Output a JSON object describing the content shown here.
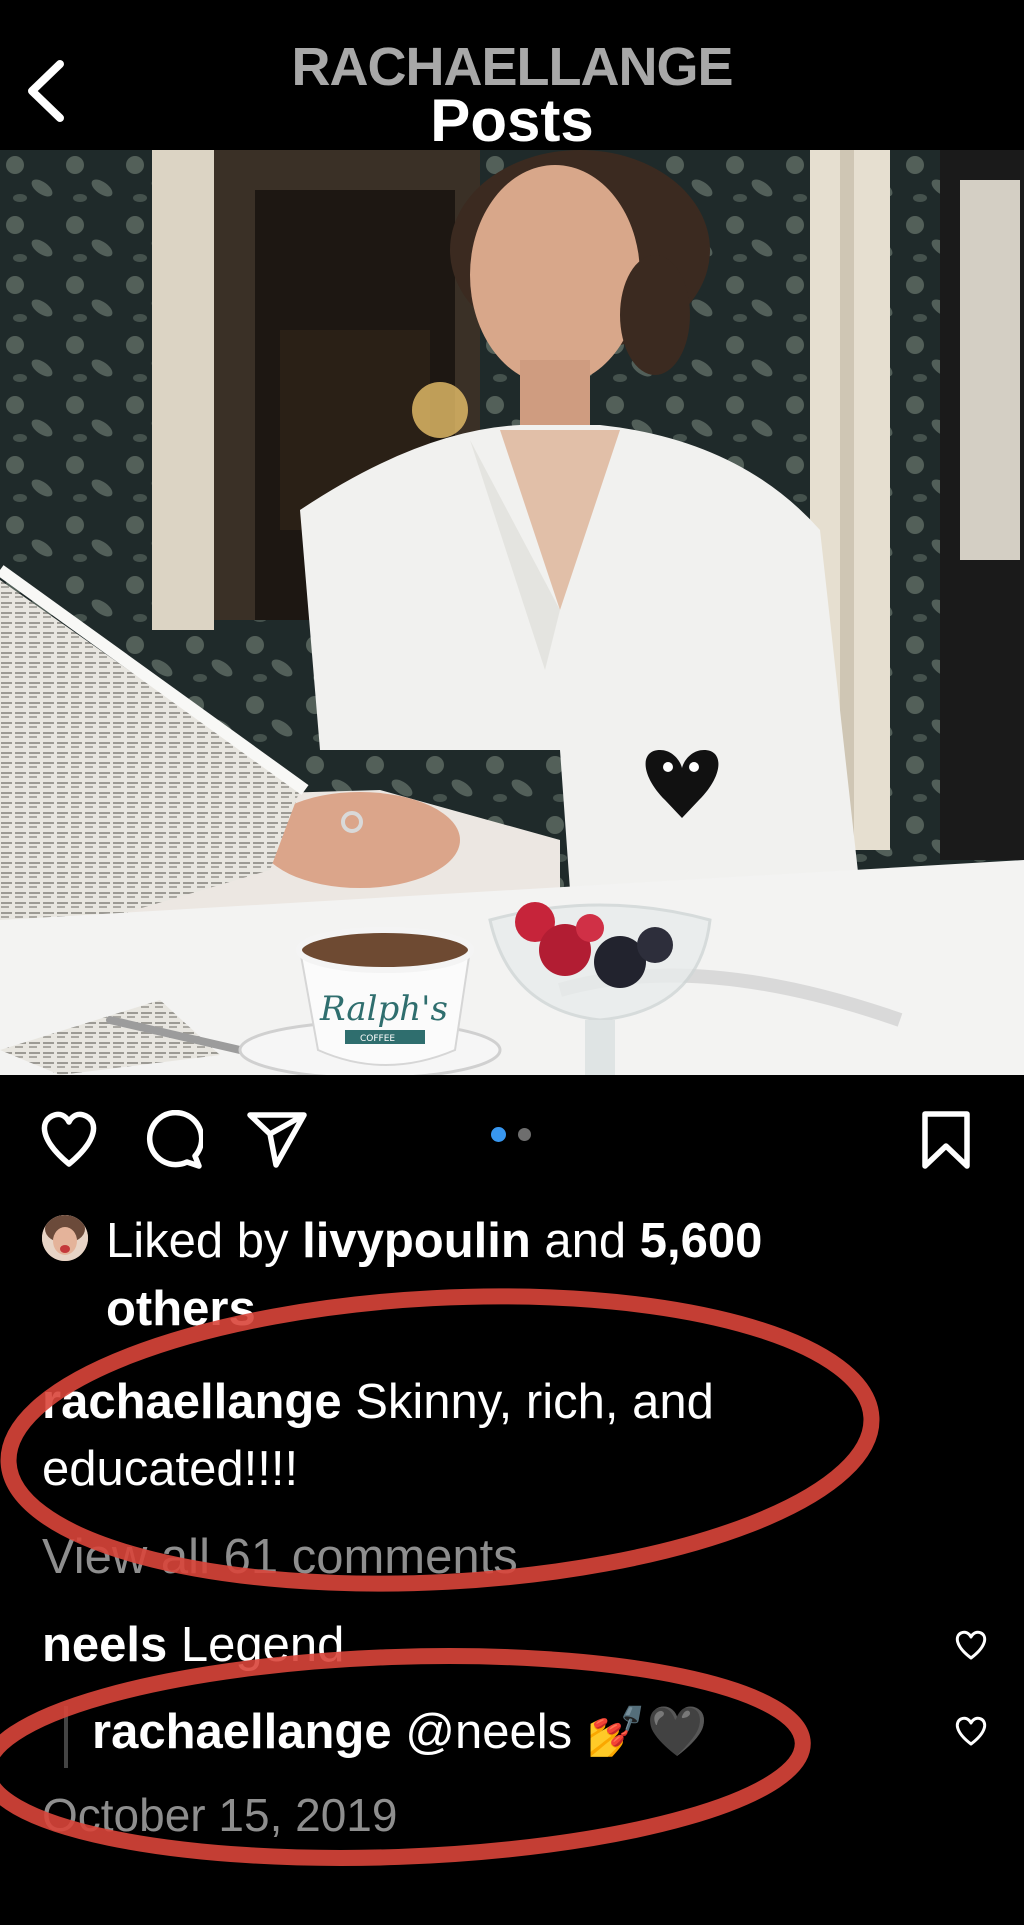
{
  "header": {
    "username": "RACHAELLANGE",
    "title": "Posts"
  },
  "pagination": {
    "dots": 2,
    "active": 1
  },
  "likes": {
    "prefix": "Liked by ",
    "liker": "livypoulin",
    "middle": " and ",
    "count": "5,600",
    "suffix": "others"
  },
  "caption": {
    "username": "rachaellange",
    "text_line1": " Skinny, rich, and",
    "text_line2": "educated!!!!"
  },
  "view_comments": "View all 61 comments",
  "comments": [
    {
      "username": "neels",
      "text": " Legend"
    }
  ],
  "reply": {
    "username": "rachaellange",
    "text": " @neels 💅🖤"
  },
  "date": "October 15, 2019",
  "photo": {
    "cup_label": "Ralph's",
    "cup_sublabel": "COFFEE"
  },
  "colors": {
    "background": "#000000",
    "active_dot": "#3897f0",
    "annotation": "#d9453a",
    "muted_text": "#8e8e8e"
  }
}
